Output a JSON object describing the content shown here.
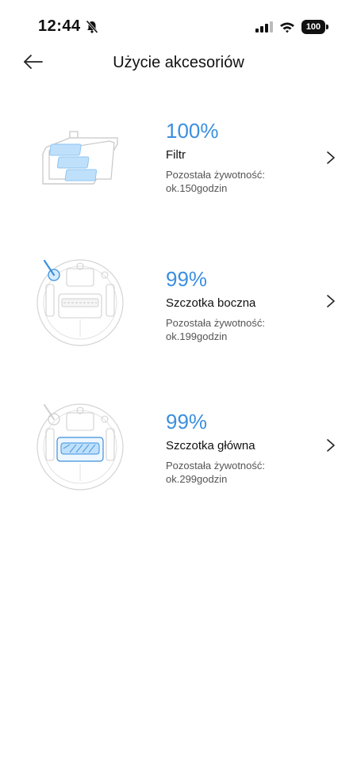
{
  "status_bar": {
    "time": "12:44",
    "battery": "100",
    "icons": [
      "bell-slash-icon",
      "signal-icon",
      "wifi-icon",
      "battery-icon"
    ]
  },
  "header": {
    "title": "Użycie akcesoriów",
    "back_icon": "arrow-left-icon"
  },
  "accessories": [
    {
      "percent": "100%",
      "name": "Filtr",
      "remaining_label": "Pozostała żywotność:",
      "remaining_value": "ok.150godzin",
      "icon": "filter-illustration"
    },
    {
      "percent": "99%",
      "name": "Szczotka boczna",
      "remaining_label": "Pozostała żywotność:",
      "remaining_value": "ok.199godzin",
      "icon": "side-brush-illustration"
    },
    {
      "percent": "99%",
      "name": "Szczotka główna",
      "remaining_label": "Pozostała żywotność:",
      "remaining_value": "ok.299godzin",
      "icon": "main-brush-illustration"
    }
  ],
  "colors": {
    "accent": "#3b8fe0",
    "highlight_fill": "#bfe0fb",
    "line": "#cfcfcf"
  }
}
